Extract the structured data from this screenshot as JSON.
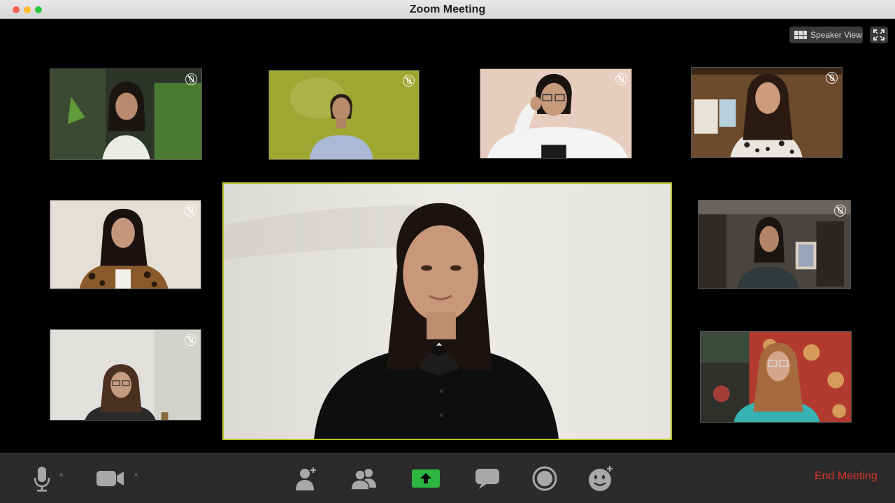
{
  "window": {
    "title": "Zoom Meeting"
  },
  "view_controls": {
    "speaker_view_label": "Speaker View"
  },
  "participants": [
    {
      "name": "",
      "muted": true,
      "bg": "#2f3a2c"
    },
    {
      "name": "",
      "muted": true,
      "bg": "#9aa534"
    },
    {
      "name": "",
      "muted": true,
      "bg": "#e4cbbb"
    },
    {
      "name": "",
      "muted": true,
      "bg": "#6e4a2d"
    },
    {
      "name": "",
      "muted": true,
      "bg": "#e4e0d8"
    },
    {
      "name": "",
      "muted": true,
      "bg": "#5b5450"
    },
    {
      "name": "",
      "muted": true,
      "bg": "#e2e0dc"
    },
    {
      "name": "",
      "muted": false,
      "bg": "#b23a2e"
    }
  ],
  "active_speaker": {
    "name": "",
    "bg": "#e9e7e3"
  },
  "toolbar": {
    "icons": [
      "microphone-icon",
      "video-camera-icon",
      "invite-icon",
      "participants-icon",
      "share-screen-icon",
      "chat-icon",
      "record-icon",
      "reactions-icon"
    ],
    "share_color": "#2db742",
    "end_meeting_label": "End Meeting",
    "end_color": "#d9332b"
  }
}
